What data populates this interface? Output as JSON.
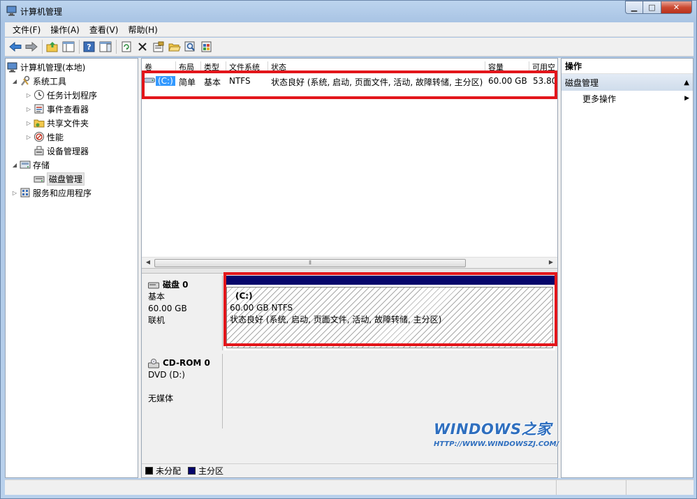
{
  "window": {
    "title": "计算机管理"
  },
  "menu": [
    {
      "label": "文件(F)"
    },
    {
      "label": "操作(A)"
    },
    {
      "label": "查看(V)"
    },
    {
      "label": "帮助(H)"
    }
  ],
  "tree": {
    "root": "计算机管理(本地)",
    "system_tools": "系统工具",
    "task_scheduler": "任务计划程序",
    "event_viewer": "事件查看器",
    "shared_folders": "共享文件夹",
    "performance": "性能",
    "device_manager": "设备管理器",
    "storage": "存储",
    "disk_management": "磁盘管理",
    "services_apps": "服务和应用程序"
  },
  "volumes": {
    "headers": [
      "卷",
      "布局",
      "类型",
      "文件系统",
      "状态",
      "容量",
      "可用空"
    ],
    "rows": [
      {
        "name": "(C:)",
        "layout": "简单",
        "type": "基本",
        "fs": "NTFS",
        "status": "状态良好 (系统, 启动, 页面文件, 活动, 故障转储, 主分区)",
        "capacity": "60.00 GB",
        "free": "53.80"
      }
    ]
  },
  "disks": [
    {
      "name": "磁盘 0",
      "kind": "基本",
      "size": "60.00 GB",
      "state": "联机",
      "partition": {
        "name": "(C:)",
        "size_fs": "60.00 GB NTFS",
        "status": "状态良好 (系统, 启动, 页面文件, 活动, 故障转储, 主分区)"
      }
    },
    {
      "name": "CD-ROM 0",
      "kind": "DVD (D:)",
      "state": "无媒体"
    }
  ],
  "legend": [
    {
      "label": "未分配",
      "color": "#000000"
    },
    {
      "label": "主分区",
      "color": "#06066b"
    }
  ],
  "actions": {
    "header": "操作",
    "section": "磁盘管理",
    "more": "更多操作"
  },
  "watermark": {
    "title": "WINDOWS之家",
    "url": "HTTP://WWW.WINDOWSZJ.COM/"
  },
  "colors": {
    "highlight_box": "#e3161b",
    "primary_partition": "#06066b",
    "accent": "#2f6fbf"
  }
}
